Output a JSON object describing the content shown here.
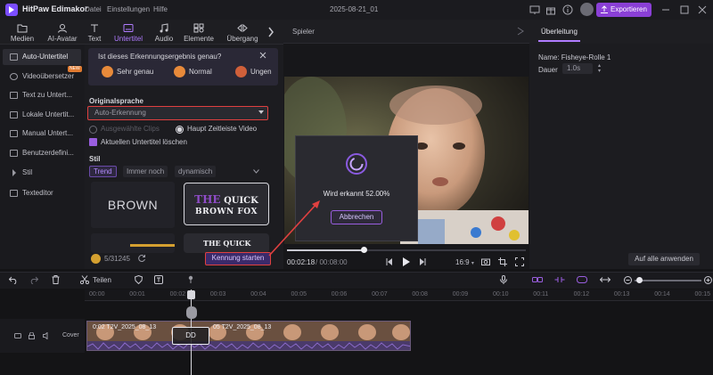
{
  "app": {
    "name": "HitPaw Edimakor",
    "menu": [
      "Datei",
      "Einstellungen",
      "Hilfe"
    ],
    "doc_title": "2025-08-21_01",
    "export_label": "Exportieren",
    "accent_color": "#8a3fd6",
    "highlight_color": "#e04040"
  },
  "toolbar": {
    "tools": [
      {
        "label": "Medien",
        "icon": "folder-icon"
      },
      {
        "label": "AI-Avatar",
        "icon": "ai-avatar-icon"
      },
      {
        "label": "Text",
        "icon": "text-icon"
      },
      {
        "label": "Untertitel",
        "icon": "subtitle-icon"
      },
      {
        "label": "Audio",
        "icon": "music-note-icon"
      },
      {
        "label": "Elemente",
        "icon": "elements-icon"
      },
      {
        "label": "Übergang",
        "icon": "transition-icon"
      }
    ],
    "active": "Untertitel"
  },
  "sidebar": {
    "items": [
      {
        "label": "Auto-Untertitel",
        "active": true
      },
      {
        "label": "Videoübersetzer",
        "badge": "NEW"
      },
      {
        "label": "Text zu Untert..."
      },
      {
        "label": "Lokale Untertit..."
      },
      {
        "label": "Manual Untert..."
      },
      {
        "label": "Benutzerdefini..."
      },
      {
        "label": "Stil"
      },
      {
        "label": "Texteditor"
      }
    ]
  },
  "subtitle_panel": {
    "feedback_question": "Ist dieses Erkennungsergebnis genau?",
    "feedback_options": [
      "Sehr genau",
      "Normal",
      "Ungen"
    ],
    "source_language_label": "Originalsprache",
    "source_language_value": "Auto-Erkennung",
    "radio_options": [
      {
        "label": "Ausgewählte Clips",
        "selected": false,
        "disabled": true
      },
      {
        "label": "Haupt Zeitleiste Video",
        "selected": true
      }
    ],
    "checkbox_label": "Aktuellen Untertitel löschen",
    "checkbox_checked": true,
    "style_label": "Stil",
    "style_tabs": [
      "Trend",
      "Immer noch",
      "dynamisch"
    ],
    "style_tab_active": "Trend",
    "style_cards": {
      "brown": "BROWN",
      "quick_line1_the": "THE",
      "quick_line1_rest": "QUICK",
      "quick_line2": "BROWN FOX",
      "partial": "THE QUICK"
    },
    "credits": "5/31245",
    "start_button": "Kennung starten"
  },
  "player": {
    "label": "Spieler",
    "time_current": "00:02:18",
    "time_total": "/ 00:08:00",
    "aspect_ratio": "16:9",
    "progress": 0.29,
    "modal": {
      "status_text": "Wird erkannt 52.00%",
      "progress_percent": 52.0,
      "cancel_label": "Abbrechen"
    }
  },
  "properties": {
    "tab": "Überleitung",
    "name_label": "Name: Fisheye-Rolle 1",
    "duration_label": "Dauer",
    "duration_value": "1.0s",
    "apply_all": "Auf alle anwenden"
  },
  "timeline": {
    "split_label": "Teilen",
    "ruler_ticks": [
      "00:00",
      "00:01",
      "00:02",
      "00:03",
      "00:04",
      "00:05",
      "00:06",
      "00:07",
      "00:08",
      "00:09",
      "00:10",
      "00:11",
      "00:12",
      "00:13",
      "00:14",
      "00:15"
    ],
    "track_label": "Cover",
    "clip_label_1": "0:02 T2V_2025_08_13",
    "clip_label_2": "05 T2V_2025_08_13",
    "playhead_tooltip": "DD"
  }
}
